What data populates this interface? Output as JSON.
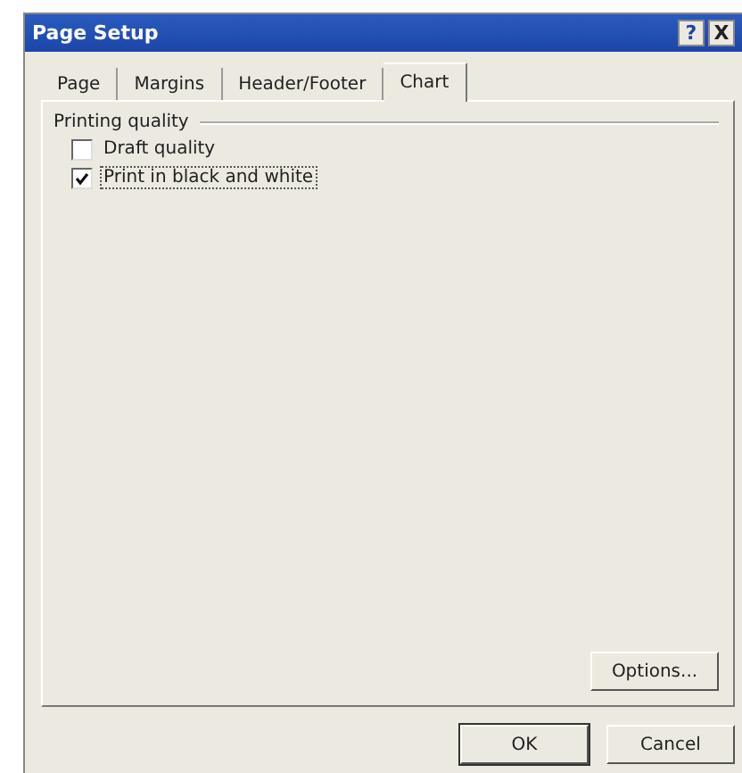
{
  "window": {
    "title": "Page Setup",
    "help": "?",
    "close": "X"
  },
  "tabs": [
    {
      "label": "Page",
      "selected": false
    },
    {
      "label": "Margins",
      "selected": false
    },
    {
      "label": "Header/Footer",
      "selected": false
    },
    {
      "label": "Chart",
      "selected": true
    }
  ],
  "group": {
    "title": "Printing quality",
    "options": [
      {
        "label": "Draft quality",
        "checked": false
      },
      {
        "label": "Print in black and white",
        "checked": true
      }
    ]
  },
  "options_button": "Options...",
  "buttons": [
    "OK",
    "Cancel"
  ]
}
